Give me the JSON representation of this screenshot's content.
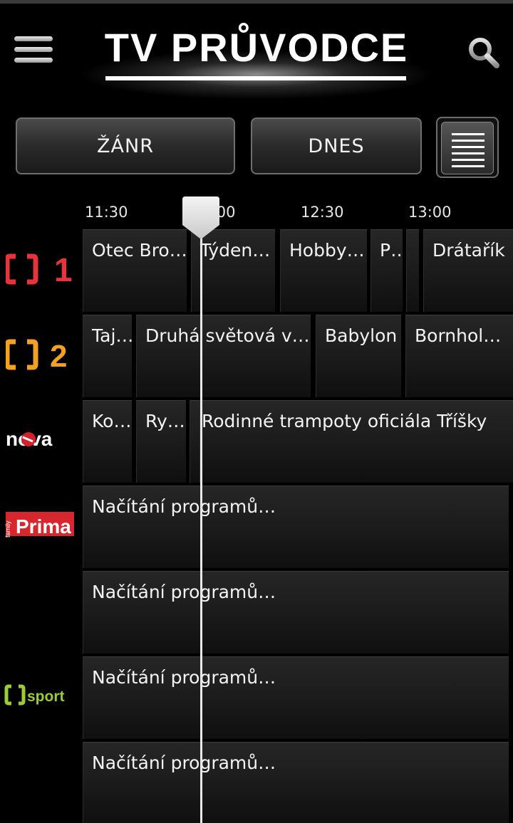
{
  "header": {
    "title": "TV PRŮVODCE",
    "menu_icon": "hamburger-menu-icon",
    "search_icon": "search-icon"
  },
  "controls": {
    "genre_label": "ŽÁNR",
    "date_label": "DNES",
    "view_icon": "list-view-icon"
  },
  "timeline": {
    "labels": [
      "11:30",
      "12:00",
      "12:30",
      "13:00"
    ],
    "now_marker_icon": "current-time-marker-icon"
  },
  "channels": [
    {
      "name": "ČT1",
      "logo_text": "1",
      "color": "#e8323c",
      "programs": [
        "Otec Bro…",
        "Týden…",
        "Hobby…",
        "P…",
        "",
        "Drátařík"
      ]
    },
    {
      "name": "ČT2",
      "logo_text": "2",
      "color": "#f3a11f",
      "programs": [
        "Taj…",
        "Druhá světová v…",
        "Babylon",
        "Bornhol…"
      ]
    },
    {
      "name": "nova",
      "logo_text": "nova",
      "color": "#d7202a",
      "programs": [
        "Ko…",
        "Ry…",
        "",
        "Rodinné trampoty oficiála Tříšky"
      ]
    },
    {
      "name": "Prima family",
      "logo_text": "Prima",
      "logo_small": "family",
      "color": "#d8262e",
      "programs": [
        "Načítání programů…"
      ]
    },
    {
      "name": "",
      "programs": [
        "Načítání programů…"
      ]
    },
    {
      "name": "ČT sport",
      "logo_text": "sport",
      "color": "#9acd32",
      "programs": [
        "Načítání programů…"
      ]
    },
    {
      "name": "",
      "programs": [
        "Načítání programů…"
      ]
    }
  ]
}
